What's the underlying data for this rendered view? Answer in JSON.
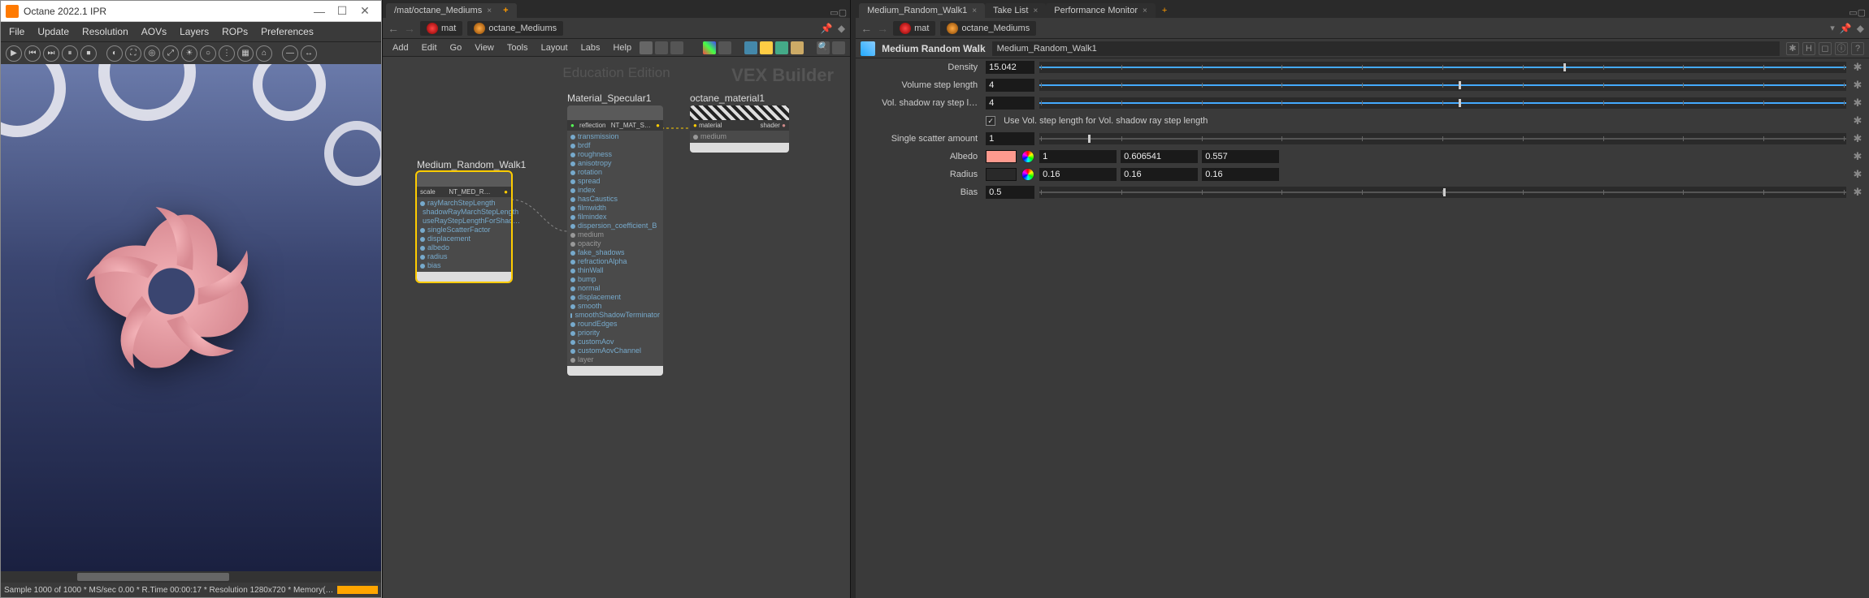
{
  "ipr": {
    "title": "Octane 2022.1 IPR",
    "menu": [
      "File",
      "Update",
      "Resolution",
      "AOVs",
      "Layers",
      "ROPs",
      "Preferences"
    ],
    "status": "Sample 1000 of 1000 * MS/sec 0.00 * R.Time 00:00:17 * Resolution 1280x720 * Memory(…",
    "progress": "100%"
  },
  "mid": {
    "tab": "/mat/octane_Mediums",
    "path1": "mat",
    "path2": "octane_Mediums",
    "menu": [
      "Add",
      "Edit",
      "Go",
      "View",
      "Tools",
      "Layout",
      "Labs",
      "Help"
    ],
    "watermark1": "Education Edition",
    "watermark2": "VEX Builder",
    "node_medium": {
      "title": "Medium_Random_Walk1",
      "type_l": "scale",
      "type_r": "NT_MED_R…",
      "ports": [
        "rayMarchStepLength",
        "shadowRayMarchStepLength",
        "useRayStepLengthForShad…",
        "singleScatterFactor",
        "displacement",
        "albedo",
        "radius",
        "bias"
      ]
    },
    "node_spec": {
      "title": "Material_Specular1",
      "type_l": "reflection",
      "type_r": "NT_MAT_S…",
      "ports": [
        "transmission",
        "brdf",
        "roughness",
        "anisotropy",
        "rotation",
        "spread",
        "index",
        "hasCaustics",
        "filmwidth",
        "filmindex",
        "dispersion_coefficient_B",
        "medium",
        "opacity",
        "fake_shadows",
        "refractionAlpha",
        "thinWall",
        "bump",
        "normal",
        "displacement",
        "smooth",
        "smoothShadowTerminator",
        "roundEdges",
        "priority",
        "customAov",
        "customAovChannel",
        "layer"
      ]
    },
    "node_out": {
      "title": "octane_material1",
      "p1": "material",
      "p2": "medium",
      "out": "shader"
    }
  },
  "right": {
    "tabs": [
      "Medium_Random_Walk1",
      "Take List",
      "Performance Monitor"
    ],
    "path1": "mat",
    "path2": "octane_Mediums",
    "type": "Medium Random Walk",
    "name": "Medium_Random_Walk1",
    "params": {
      "density_l": "Density",
      "density_v": "15.042",
      "vstep_l": "Volume step length",
      "vstep_v": "4",
      "vshad_l": "Vol. shadow ray step l…",
      "vshad_v": "4",
      "chk_l": "Use Vol. step length for Vol. shadow ray step length",
      "scat_l": "Single scatter amount",
      "scat_v": "1",
      "albedo_l": "Albedo",
      "albedo_r": "1",
      "albedo_g": "0.606541",
      "albedo_b": "0.557",
      "radius_l": "Radius",
      "radius_r": "0.16",
      "radius_g": "0.16",
      "radius_b": "0.16",
      "bias_l": "Bias",
      "bias_v": "0.5",
      "albedo_hex": "#ff9a8e",
      "radius_hex": "#292929"
    }
  }
}
